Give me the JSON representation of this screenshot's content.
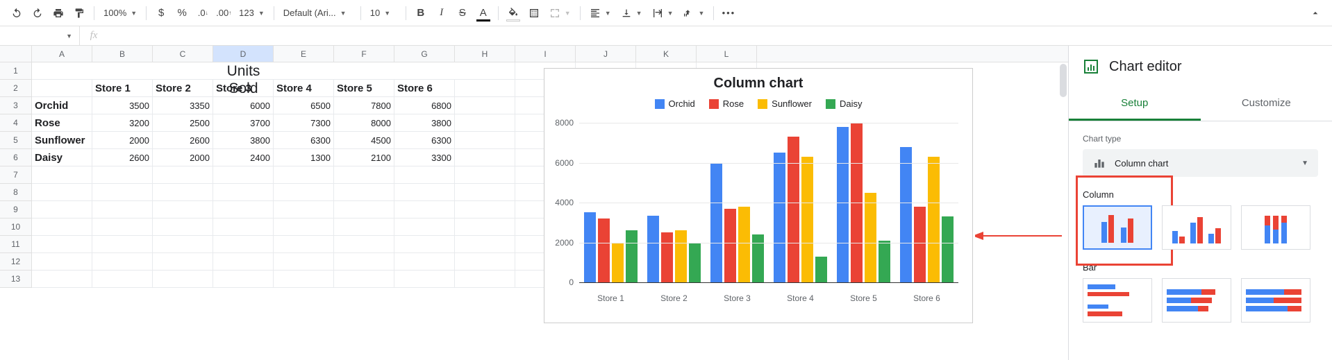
{
  "toolbar": {
    "zoom": "100%",
    "font": "Default (Ari...",
    "font_size": "10",
    "more_formats": "123"
  },
  "sheet": {
    "columns": [
      "A",
      "B",
      "C",
      "D",
      "E",
      "F",
      "G",
      "H",
      "I",
      "J",
      "K",
      "L"
    ],
    "selected_col": "D",
    "title": "Units Sold",
    "headers": [
      "Store 1",
      "Store 2",
      "Store 3",
      "Store 4",
      "Store 5",
      "Store 6"
    ],
    "rows": [
      {
        "label": "Orchid",
        "cells": [
          "3500",
          "3350",
          "6000",
          "6500",
          "7800",
          "6800"
        ]
      },
      {
        "label": "Rose",
        "cells": [
          "3200",
          "2500",
          "3700",
          "7300",
          "8000",
          "3800"
        ]
      },
      {
        "label": "Sunflower",
        "cells": [
          "2000",
          "2600",
          "3800",
          "6300",
          "4500",
          "6300"
        ]
      },
      {
        "label": "Daisy",
        "cells": [
          "2600",
          "2000",
          "2400",
          "1300",
          "2100",
          "3300"
        ]
      }
    ],
    "row_nums": [
      "1",
      "2",
      "3",
      "4",
      "5",
      "6",
      "7",
      "8",
      "9",
      "10",
      "11",
      "12",
      "13"
    ]
  },
  "chart_data": {
    "type": "bar",
    "title": "Column chart",
    "categories": [
      "Store 1",
      "Store 2",
      "Store 3",
      "Store 4",
      "Store 5",
      "Store 6"
    ],
    "series": [
      {
        "name": "Orchid",
        "color": "#4285f4",
        "values": [
          3500,
          3350,
          6000,
          6500,
          7800,
          6800
        ]
      },
      {
        "name": "Rose",
        "color": "#ea4335",
        "values": [
          3200,
          2500,
          3700,
          7300,
          8000,
          3800
        ]
      },
      {
        "name": "Sunflower",
        "color": "#fbbc04",
        "values": [
          2000,
          2600,
          3800,
          6300,
          4500,
          6300
        ]
      },
      {
        "name": "Daisy",
        "color": "#34a853",
        "values": [
          2600,
          2000,
          2400,
          1300,
          2100,
          3300
        ]
      }
    ],
    "y_ticks": [
      "8000",
      "6000",
      "4000",
      "2000",
      "0"
    ],
    "y_max": 8000
  },
  "editor": {
    "title": "Chart editor",
    "tabs": {
      "setup": "Setup",
      "customize": "Customize"
    },
    "chart_type_label": "Chart type",
    "chart_type_value": "Column chart",
    "sections": {
      "column": "Column",
      "bar": "Bar"
    }
  }
}
